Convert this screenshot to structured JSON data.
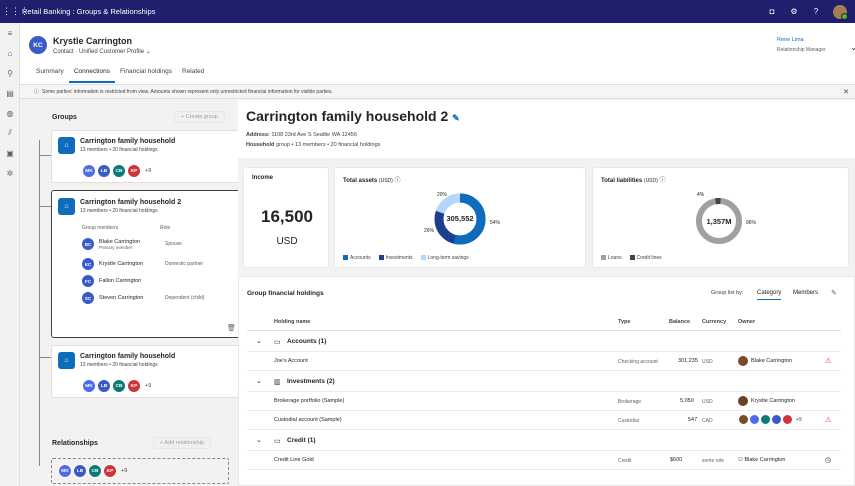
{
  "topbar": {
    "title": "Retail Banking : Groups & Relationships"
  },
  "header": {
    "initials": "KC",
    "name": "Krystle Carrington",
    "subtitle": "Contact · Unified Customer Profile",
    "owner_name": "Rene Lima",
    "owner_role": "Relationship Manager",
    "tabs": [
      "Summary",
      "Connections",
      "Financial holdings",
      "Related"
    ],
    "active_tab": "Connections"
  },
  "banner": {
    "text": "Some parties' information is restricted from view. Amounts shown represent only unrestricted financial information for visible parties."
  },
  "groups": {
    "title": "Groups",
    "create_label": "+ Create group",
    "cards": [
      {
        "name": "Carrington family household",
        "sub": "13 members • 20 financial holdings",
        "more": "+9"
      },
      {
        "name": "Carrington family household 2",
        "sub": "13 members • 20 financial holdings",
        "col_members": "Group members",
        "col_role": "Role",
        "members": [
          {
            "initials": "BC",
            "name": "Blake Carrington",
            "sub": "Primary member",
            "role": "Spouse",
            "color": "#3a5bc7"
          },
          {
            "initials": "KC",
            "name": "Krystle Carrington",
            "sub": "",
            "role": "Domestic partner",
            "color": "#3a5bc7"
          },
          {
            "initials": "FC",
            "name": "Fallon Carrington",
            "sub": "",
            "role": "",
            "color": "#3a5bc7"
          },
          {
            "initials": "SC",
            "name": "Steven Carrington",
            "sub": "",
            "role": "Dependent (child)",
            "color": "#3a5bc7"
          }
        ]
      },
      {
        "name": "Carrington family household",
        "sub": "13 members • 20 financial holdings",
        "more": "+9"
      }
    ],
    "avatars": [
      {
        "initials": "MK",
        "color": "#4f6bed"
      },
      {
        "initials": "LB",
        "color": "#3a5bc7"
      },
      {
        "initials": "CB",
        "color": "#0b7a75"
      },
      {
        "initials": "KP",
        "color": "#d13438"
      }
    ]
  },
  "relationships": {
    "title": "Relationships",
    "add_label": "+ Add relationship",
    "more": "+9"
  },
  "household": {
    "title": "Carrington family household 2",
    "address_label": "Address:",
    "address": "1108 23rd Ave S Seattle WA 12456",
    "type_label": "Household",
    "type_rest": "group • 13 members • 20 financial holdings"
  },
  "income": {
    "label": "Income",
    "value": "16,500",
    "unit": "USD"
  },
  "assets": {
    "label": "Total assets",
    "unit": "(USD)",
    "total": "305,552",
    "pct_accounts": "54%",
    "pct_investments": "26%",
    "pct_savings": "20%",
    "legend": [
      "Accounts",
      "Investments",
      "Long-term savings"
    ],
    "colors": [
      "#0f6cbd",
      "#1e3f8f",
      "#b4d6fa"
    ]
  },
  "liabilities": {
    "label": "Total liabilities",
    "unit": "(USD)",
    "total": "1,357M",
    "pct_loans": "96%",
    "pct_credit": "4%",
    "legend": [
      "Loans",
      "Credit lines"
    ],
    "colors": [
      "#a0a0a0",
      "#424242"
    ]
  },
  "holdings": {
    "title": "Group financial holdings",
    "list_by": "Group list by:",
    "opt_category": "Category",
    "opt_members": "Members",
    "cols": [
      "Holding name",
      "Type",
      "Balance",
      "Currency",
      "Owner"
    ],
    "cat_accounts": "Accounts (1)",
    "cat_investments": "Investments (2)",
    "cat_credit": "Credit (1)",
    "rows": [
      {
        "name": "Joe's Account",
        "type": "Checking account",
        "balance": "301,235",
        "currency": "USD",
        "owner": "Blake Carrington"
      },
      {
        "name": "Brokerage portfolio (Sample)",
        "type": "Brokerage",
        "balance": "5,050",
        "currency": "USD",
        "owner": "Krystle Carrington"
      },
      {
        "name": "Custodial account (Sample)",
        "type": "Custodial",
        "balance": "547",
        "currency": "CAD",
        "owner": "",
        "more": "+9"
      },
      {
        "name": "Credit Line Gold",
        "type": "Credit",
        "balance": "$600",
        "currency": "some role",
        "owner": "Blake Carrington"
      }
    ]
  }
}
